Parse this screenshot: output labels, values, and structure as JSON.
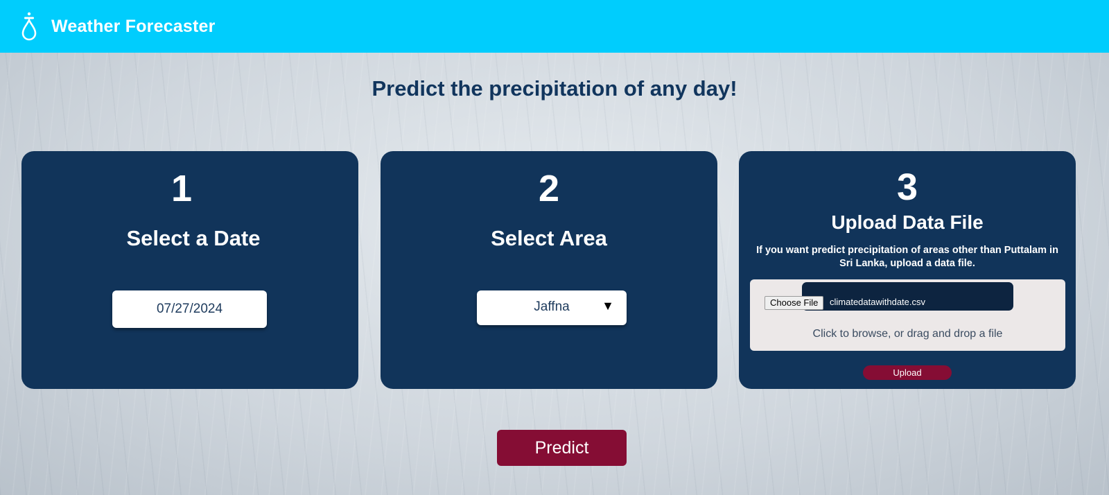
{
  "header": {
    "app_title": "Weather Forecaster",
    "logo_icon": "raindrop-logo-icon",
    "background_color": "#00cdfd"
  },
  "main": {
    "headline": "Predict the precipitation of any day!",
    "card_color": "#11345a",
    "accent_color": "#850d34"
  },
  "step1": {
    "number": "1",
    "title": "Select a Date",
    "date_value": "07/27/2024"
  },
  "step2": {
    "number": "2",
    "title": "Select Area",
    "selected_area": "Jaffna",
    "dropdown_icon": "triangle-down-icon"
  },
  "step3": {
    "number": "3",
    "title": "Upload Data File",
    "description": "If you want predict precipitation of areas other than Puttalam in Sri Lanka, upload a data file.",
    "choose_file_label": "Choose File",
    "file_name": "climatedatawithdate.csv",
    "dropzone_hint": "Click to browse, or drag and drop a file",
    "upload_label": "Upload"
  },
  "actions": {
    "predict_label": "Predict"
  }
}
